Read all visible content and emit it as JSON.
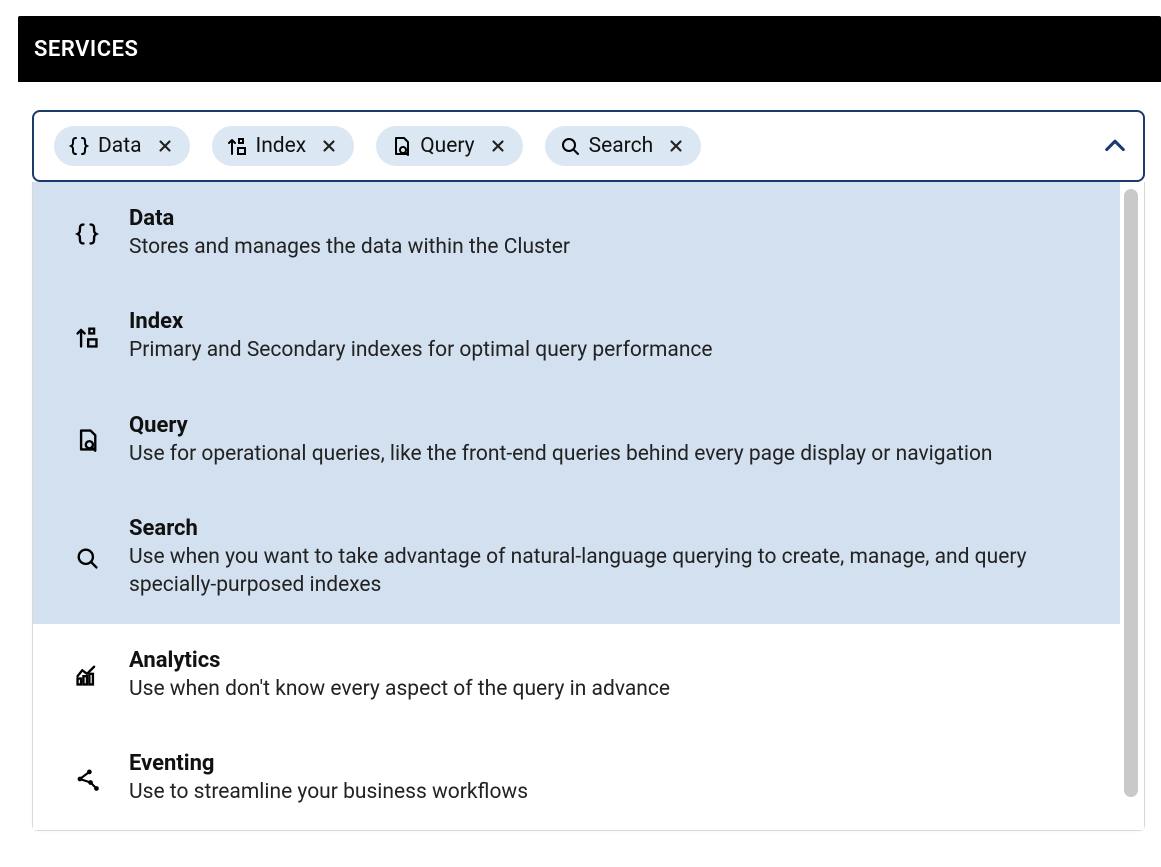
{
  "header": {
    "title": "SERVICES"
  },
  "selected": [
    {
      "id": "data",
      "label": "Data",
      "icon": "braces-icon"
    },
    {
      "id": "index",
      "label": "Index",
      "icon": "index-icon"
    },
    {
      "id": "query",
      "label": "Query",
      "icon": "file-search-icon"
    },
    {
      "id": "search",
      "label": "Search",
      "icon": "search-icon"
    }
  ],
  "options": [
    {
      "id": "data",
      "title": "Data",
      "desc": "Stores and manages the data within the Cluster",
      "icon": "braces-icon",
      "selected": true
    },
    {
      "id": "index",
      "title": "Index",
      "desc": "Primary and Secondary indexes for optimal query performance",
      "icon": "index-icon",
      "selected": true
    },
    {
      "id": "query",
      "title": "Query",
      "desc": "Use for operational queries, like the front-end queries behind every page display or navigation",
      "icon": "file-search-icon",
      "selected": true
    },
    {
      "id": "search",
      "title": "Search",
      "desc": "Use when you want to take advantage of natural-language querying to create, manage, and query specially-purposed indexes",
      "icon": "search-icon",
      "selected": true
    },
    {
      "id": "analytics",
      "title": "Analytics",
      "desc": "Use when don't know every aspect of the query in advance",
      "icon": "analytics-icon",
      "selected": false
    },
    {
      "id": "eventing",
      "title": "Eventing",
      "desc": "Use to streamline your business workflows",
      "icon": "eventing-icon",
      "selected": false
    }
  ]
}
